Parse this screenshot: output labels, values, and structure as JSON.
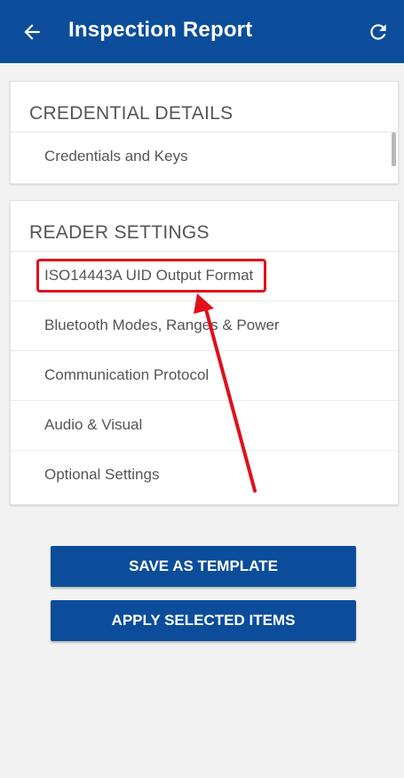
{
  "header": {
    "title": "Inspection Report",
    "back_icon": "arrow-left-icon",
    "refresh_icon": "refresh-icon",
    "background_color": "#0b4d9a"
  },
  "credential_details": {
    "heading": "CREDENTIAL DETAILS",
    "items": [
      {
        "label": "Credentials and Keys"
      }
    ]
  },
  "reader_settings": {
    "heading": "READER SETTINGS",
    "items": [
      {
        "label": "ISO14443A UID Output Format"
      },
      {
        "label": "Bluetooth Modes, Ranges & Power"
      },
      {
        "label": "Communication Protocol"
      },
      {
        "label": "Audio & Visual"
      },
      {
        "label": "Optional Settings"
      }
    ]
  },
  "actions": {
    "save_template_label": "SAVE AS TEMPLATE",
    "apply_selected_label": "APPLY SELECTED ITEMS"
  },
  "annotation": {
    "highlight_color": "#e0111b",
    "highlighted_item": "ISO14443A UID Output Format"
  }
}
